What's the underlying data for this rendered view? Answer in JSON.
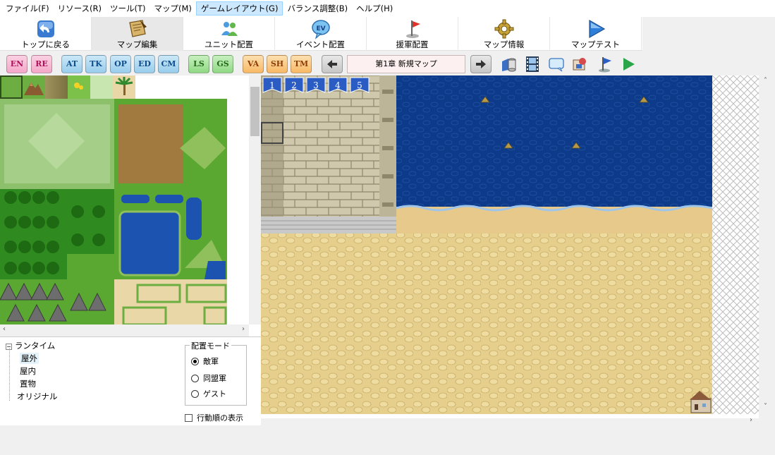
{
  "menu": [
    {
      "label": "ファイル(F)",
      "active": false
    },
    {
      "label": "リソース(R)",
      "active": false
    },
    {
      "label": "ツール(T)",
      "active": false
    },
    {
      "label": "マップ(M)",
      "active": false
    },
    {
      "label": "ゲームレイアウト(G)",
      "active": true
    },
    {
      "label": "バランス調整(B)",
      "active": false
    },
    {
      "label": "ヘルプ(H)",
      "active": false
    }
  ],
  "toolbar": [
    {
      "label": "トップに戻る",
      "icon": "back-arrow-icon"
    },
    {
      "label": "マップ編集",
      "icon": "scroll-map-icon",
      "active": true
    },
    {
      "label": "ユニット配置",
      "icon": "units-icon"
    },
    {
      "label": "イベント配置",
      "icon": "event-bubble-icon"
    },
    {
      "label": "援軍配置",
      "icon": "red-flag-icon"
    },
    {
      "label": "マップ情報",
      "icon": "gear-icon"
    },
    {
      "label": "マップテスト",
      "icon": "play-triangle-icon"
    }
  ],
  "subtoolbar": {
    "buttons": [
      "EN",
      "RE",
      "AT",
      "TK",
      "OP",
      "ED",
      "CM",
      "LS",
      "GS",
      "VA",
      "SH",
      "TM"
    ],
    "colors": {
      "EN": "pink",
      "RE": "pink",
      "AT": "blue",
      "TK": "blue",
      "OP": "blue",
      "ED": "blue",
      "CM": "blue",
      "LS": "green",
      "GS": "green",
      "VA": "orange",
      "SH": "orange",
      "TM": "orange"
    },
    "map_name": "第1章 新規マップ"
  },
  "layer_flags": [
    "1",
    "2",
    "3",
    "4",
    "5"
  ],
  "tree": {
    "root": "ランタイム",
    "children": [
      "屋外",
      "屋内",
      "置物"
    ],
    "selected": "屋外",
    "other": "オリジナル"
  },
  "place_mode": {
    "title": "配置モード",
    "options": [
      "敵軍",
      "同盟軍",
      "ゲスト"
    ],
    "selected": "敵軍"
  },
  "show_order_label": "行動順の表示",
  "colors": {
    "sea": "#0e3a8a",
    "sand": "#e6cf8c",
    "grass": "#5fa83b",
    "stone": "#cfc8ad"
  }
}
